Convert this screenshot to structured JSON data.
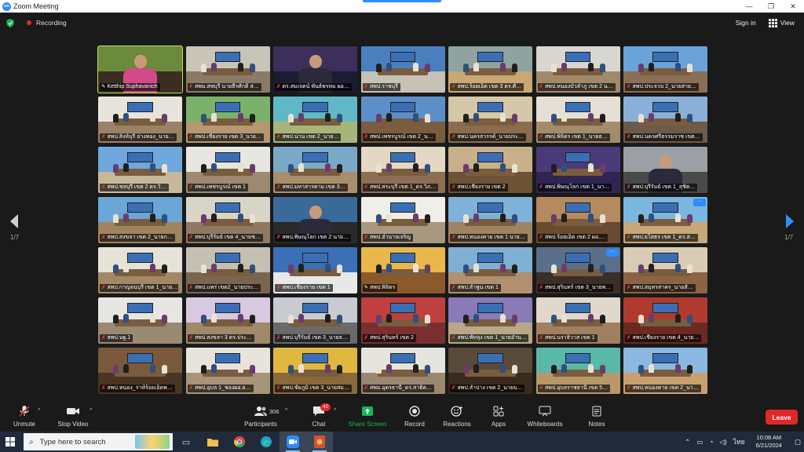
{
  "window": {
    "title": "Zoom Meeting",
    "controls": [
      "—",
      "❐",
      "✕"
    ]
  },
  "topbar": {
    "recording_label": "Recording",
    "signin_label": "Sign in",
    "view_label": "View"
  },
  "pagination": {
    "left_page": "1/7",
    "right_page": "1/7"
  },
  "participants_tiles": [
    {
      "name": "Ketthip Suphavanich",
      "muted": false,
      "wall": "#6b8a3b",
      "floor": "#3a2d22",
      "scene": "speaker"
    },
    {
      "name": "สพม.สพบุรี นายธีรศักดิ์ ส…",
      "muted": true,
      "wall": "#c9c4b8",
      "floor": "#8a7a66",
      "scene": "room"
    },
    {
      "name": "ดร.สมเจตน์ พันธ์พรหม ผอ…",
      "muted": true,
      "wall": "#3c2f5c",
      "floor": "#1d1a33",
      "scene": "person"
    },
    {
      "name": "สพป.ราชบุรี",
      "muted": true,
      "wall": "#4a7fbf",
      "floor": "#c7c2b5",
      "scene": "room"
    },
    {
      "name": "สพป.ร้อยเอ็ด เขต 3 ดร.ศั…",
      "muted": true,
      "wall": "#8fa3a0",
      "floor": "#c9a874",
      "scene": "room"
    },
    {
      "name": "สพป.หนองบัวลำภู เขต 2 น…",
      "muted": true,
      "wall": "#d8d6d0",
      "floor": "#a08a6a",
      "scene": "room"
    },
    {
      "name": "สพป.ประจวบ 2_นายสาย…",
      "muted": true,
      "wall": "#6aa3d8",
      "floor": "#8a6e55",
      "scene": "room"
    },
    {
      "name": "สพป.สิงห์บุรี อ่างทอง_นาย…",
      "muted": true,
      "wall": "#e8e4dc",
      "floor": "#9a8266",
      "scene": "room"
    },
    {
      "name": "สพป.เชียงราย เขต 3_นาย…",
      "muted": true,
      "wall": "#7ab26a",
      "floor": "#b59870",
      "scene": "room"
    },
    {
      "name": "สพป.น่าน เขต 2_นาย…",
      "muted": true,
      "wall": "#5fb8c8",
      "floor": "#a8b57a",
      "scene": "room"
    },
    {
      "name": "สพป.เพชรบูรณ์ เขต 2_น…",
      "muted": true,
      "wall": "#5c8fc7",
      "floor": "#7a5c40",
      "scene": "room"
    },
    {
      "name": "สพป.นครสวรรค์_นายประ…",
      "muted": true,
      "wall": "#d4c8a8",
      "floor": "#8a6d4e",
      "scene": "room"
    },
    {
      "name": "สพป.พิจิตร เขต 1_นายธ…",
      "muted": true,
      "wall": "#e5e0d6",
      "floor": "#a48b6a",
      "scene": "room"
    },
    {
      "name": "สพป.นครศรีธรรมราช เขต…",
      "muted": true,
      "wall": "#8ab0d8",
      "floor": "#6d5a48",
      "scene": "room"
    },
    {
      "name": "สพป.ชลบุรี เขต 2 ดร.วิ…",
      "muted": true,
      "wall": "#6fa8dc",
      "floor": "#c8b89a",
      "scene": "room"
    },
    {
      "name": "สพป.เพชรบูรณ์ เขต 1",
      "muted": true,
      "wall": "#e8e6e0",
      "floor": "#9e8a70",
      "scene": "room"
    },
    {
      "name": "สพป.มหาสารคาม เขต 3…",
      "muted": true,
      "wall": "#7aa9c8",
      "floor": "#a88e6c",
      "scene": "room"
    },
    {
      "name": "สพป.สระบุรี เขต 1_ดร.วิภ…",
      "muted": true,
      "wall": "#e3d8c4",
      "floor": "#8c6f52",
      "scene": "room"
    },
    {
      "name": "สพป.เชียงราย เขต 2",
      "muted": true,
      "wall": "#c7b08a",
      "floor": "#6e5236",
      "scene": "room"
    },
    {
      "name": "สพป.พิษณุโลก เขต 1_นา…",
      "muted": true,
      "wall": "#4a3a7a",
      "floor": "#2f2550",
      "scene": "room"
    },
    {
      "name": "สพป.บุรีรัมย์ เขต 1_สุชิต…",
      "muted": true,
      "wall": "#9aa0a6",
      "floor": "#4a4a4a",
      "scene": "person"
    },
    {
      "name": "สพป.สงขลา เขต 2_นายก…",
      "muted": true,
      "wall": "#6aa6d6",
      "floor": "#a0845e",
      "scene": "room"
    },
    {
      "name": "สพป.บุรีรัมย์ เขต 4_นายช…",
      "muted": true,
      "wall": "#d9d4c8",
      "floor": "#8e7a62",
      "scene": "room"
    },
    {
      "name": "สพป.พิษณุโลก เขต 2 นาย…",
      "muted": true,
      "wall": "#3a6a9a",
      "floor": "#2a2a2a",
      "scene": "person"
    },
    {
      "name": "สพป.อำนาจเจริญ",
      "muted": true,
      "wall": "#f0eee8",
      "floor": "#a89880",
      "scene": "room"
    },
    {
      "name": "สพป.หนองคาย เขต 1 นาย…",
      "muted": true,
      "wall": "#7eb2d8",
      "floor": "#9e8462",
      "scene": "room"
    },
    {
      "name": "สพป.ร้อยเอ็ด เขต 2 ผอ.…",
      "muted": true,
      "wall": "#b58a5e",
      "floor": "#6a4a30",
      "scene": "room"
    },
    {
      "name": "สพป.ยโสธร เขต 1_ดร.ส…",
      "muted": true,
      "wall": "#7ab8e0",
      "floor": "#c8a878",
      "scene": "room",
      "more": true
    },
    {
      "name": "สพป.กาญจนบุรี เขต 1_นาย…",
      "muted": true,
      "wall": "#e6e2d8",
      "floor": "#a38866",
      "scene": "room"
    },
    {
      "name": "สพป.แพร่ เขต2_นายประ…",
      "muted": true,
      "wall": "#c6c0b4",
      "floor": "#7a6650",
      "scene": "room"
    },
    {
      "name": "สพป.เชียงราย เขต 1",
      "muted": true,
      "wall": "#3b6fb8",
      "floor": "#e8e8e8",
      "scene": "room"
    },
    {
      "name": "สพป.พิจิตร",
      "muted": false,
      "wall": "#e8b84a",
      "floor": "#8a5a2a",
      "scene": "room"
    },
    {
      "name": "สพป.ลำพูน เขต 1",
      "muted": true,
      "wall": "#7fb0d4",
      "floor": "#b09070",
      "scene": "room"
    },
    {
      "name": "สพป.สุรินทร์ เขต 3_นายพ…",
      "muted": true,
      "wall": "#5a6f8a",
      "floor": "#3a2e26",
      "scene": "room",
      "more": true
    },
    {
      "name": "สพป.สมุทรสาคร_นายสั…",
      "muted": true,
      "wall": "#d8cdb4",
      "floor": "#8a6444",
      "scene": "room"
    },
    {
      "name": "สพป.นฐ.1",
      "muted": true,
      "wall": "#e8e6e2",
      "floor": "#9a8a74",
      "scene": "room"
    },
    {
      "name": "สพป.สงขลา 3 ดร.ประ…",
      "muted": true,
      "wall": "#d8c8e0",
      "floor": "#a08a6a",
      "scene": "room"
    },
    {
      "name": "สพป.บุรีรัมย์ เขต 3_นายธ…",
      "muted": true,
      "wall": "#c8ccd0",
      "floor": "#6a6a6a",
      "scene": "room"
    },
    {
      "name": "สพป.สุรินทร์ เขต 2",
      "muted": true,
      "wall": "#c04040",
      "floor": "#7a3030",
      "scene": "room"
    },
    {
      "name": "สพป.พัทลุง เขต 1_นายอำน…",
      "muted": true,
      "wall": "#8a7ab8",
      "floor": "#b8a888",
      "scene": "room"
    },
    {
      "name": "สพป.นราธิวาส เขต 1",
      "muted": true,
      "wall": "#e0d8cc",
      "floor": "#a08060",
      "scene": "room"
    },
    {
      "name": "สพป.เชียงราย เขต 4_นาย…",
      "muted": true,
      "wall": "#b03a2e",
      "floor": "#6a2a22",
      "scene": "room"
    },
    {
      "name": "สพป.หนอง_ร่าห์ร้อยเอ็ดพ…",
      "muted": true,
      "wall": "#7a5a3a",
      "floor": "#4a3422",
      "scene": "room"
    },
    {
      "name": "สพป.อุบล 1_ชองผอ.ย…",
      "muted": true,
      "wall": "#e8e4dc",
      "floor": "#a89478",
      "scene": "room"
    },
    {
      "name": "สพป.ชัยภูมิ เขต 3_นายสม…",
      "muted": true,
      "wall": "#e0b840",
      "floor": "#8a6a3a",
      "scene": "room"
    },
    {
      "name": "สพม.อุดรธานี_ดร.สาธิต…",
      "muted": true,
      "wall": "#e6e4de",
      "floor": "#9a8870",
      "scene": "room"
    },
    {
      "name": "สพป.ลำปาง เขต 2_นายบ…",
      "muted": true,
      "wall": "#5a4a3a",
      "floor": "#3a2a1e",
      "scene": "room"
    },
    {
      "name": "สพป.อุบลราชธานี เขต 5…",
      "muted": true,
      "wall": "#5ab8a8",
      "floor": "#b89868",
      "scene": "room"
    },
    {
      "name": "สพป.หนองคาย เขต 2_นา…",
      "muted": true,
      "wall": "#8ab8e0",
      "floor": "#c8a070",
      "scene": "room"
    }
  ],
  "toolbar": {
    "unmute_label": "Unmute",
    "stop_video_label": "Stop Video",
    "participants_label": "Participants",
    "participants_count": "306",
    "chat_label": "Chat",
    "chat_badge": "42",
    "share_label": "Share Screen",
    "record_label": "Record",
    "reactions_label": "Reactions",
    "apps_label": "Apps",
    "whiteboards_label": "Whiteboards",
    "notes_label": "Notes",
    "leave_label": "Leave"
  },
  "taskbar": {
    "search_placeholder": "Type here to search",
    "lang": "ไทย",
    "time": "10:08 AM",
    "date": "6/21/2024"
  },
  "colors": {
    "zoom_blue": "#2d8cff",
    "leave_red": "#e02828",
    "share_green": "#19b35a",
    "active_speaker": "#c7e540"
  }
}
